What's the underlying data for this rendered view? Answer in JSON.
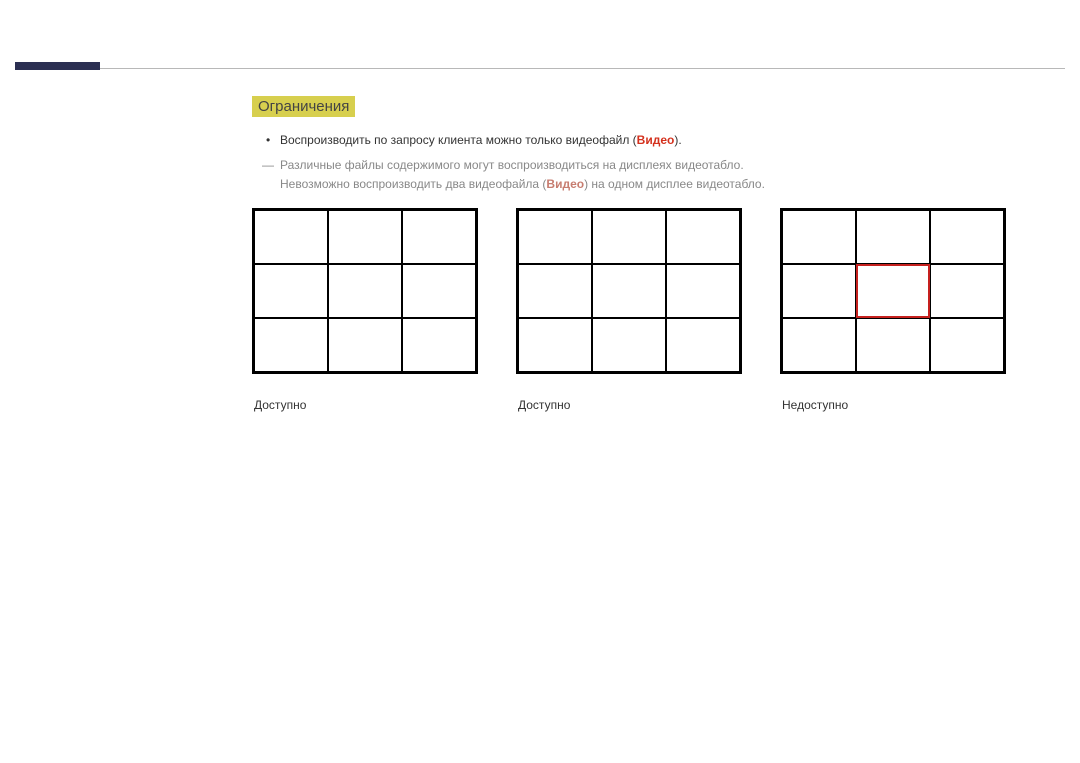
{
  "header": {
    "section_title": "Ограничения"
  },
  "text": {
    "bullet1_pre": "Воспроизводить по запросу клиента можно только видеофайл (",
    "bullet1_video": "Видео",
    "bullet1_post": ").",
    "note1": "Различные файлы содержимого могут воспроизводиться на дисплеях видеотабло.",
    "note2_pre": "Невозможно воспроизводить два видеофайла (",
    "note2_video": "Видео",
    "note2_post": ") на одном дисплее видеотабло."
  },
  "grids": [
    {
      "label": "Доступно",
      "highlight_cell": null
    },
    {
      "label": "Доступно",
      "highlight_cell": null
    },
    {
      "label": "Недоступно",
      "highlight_cell": 4
    }
  ]
}
